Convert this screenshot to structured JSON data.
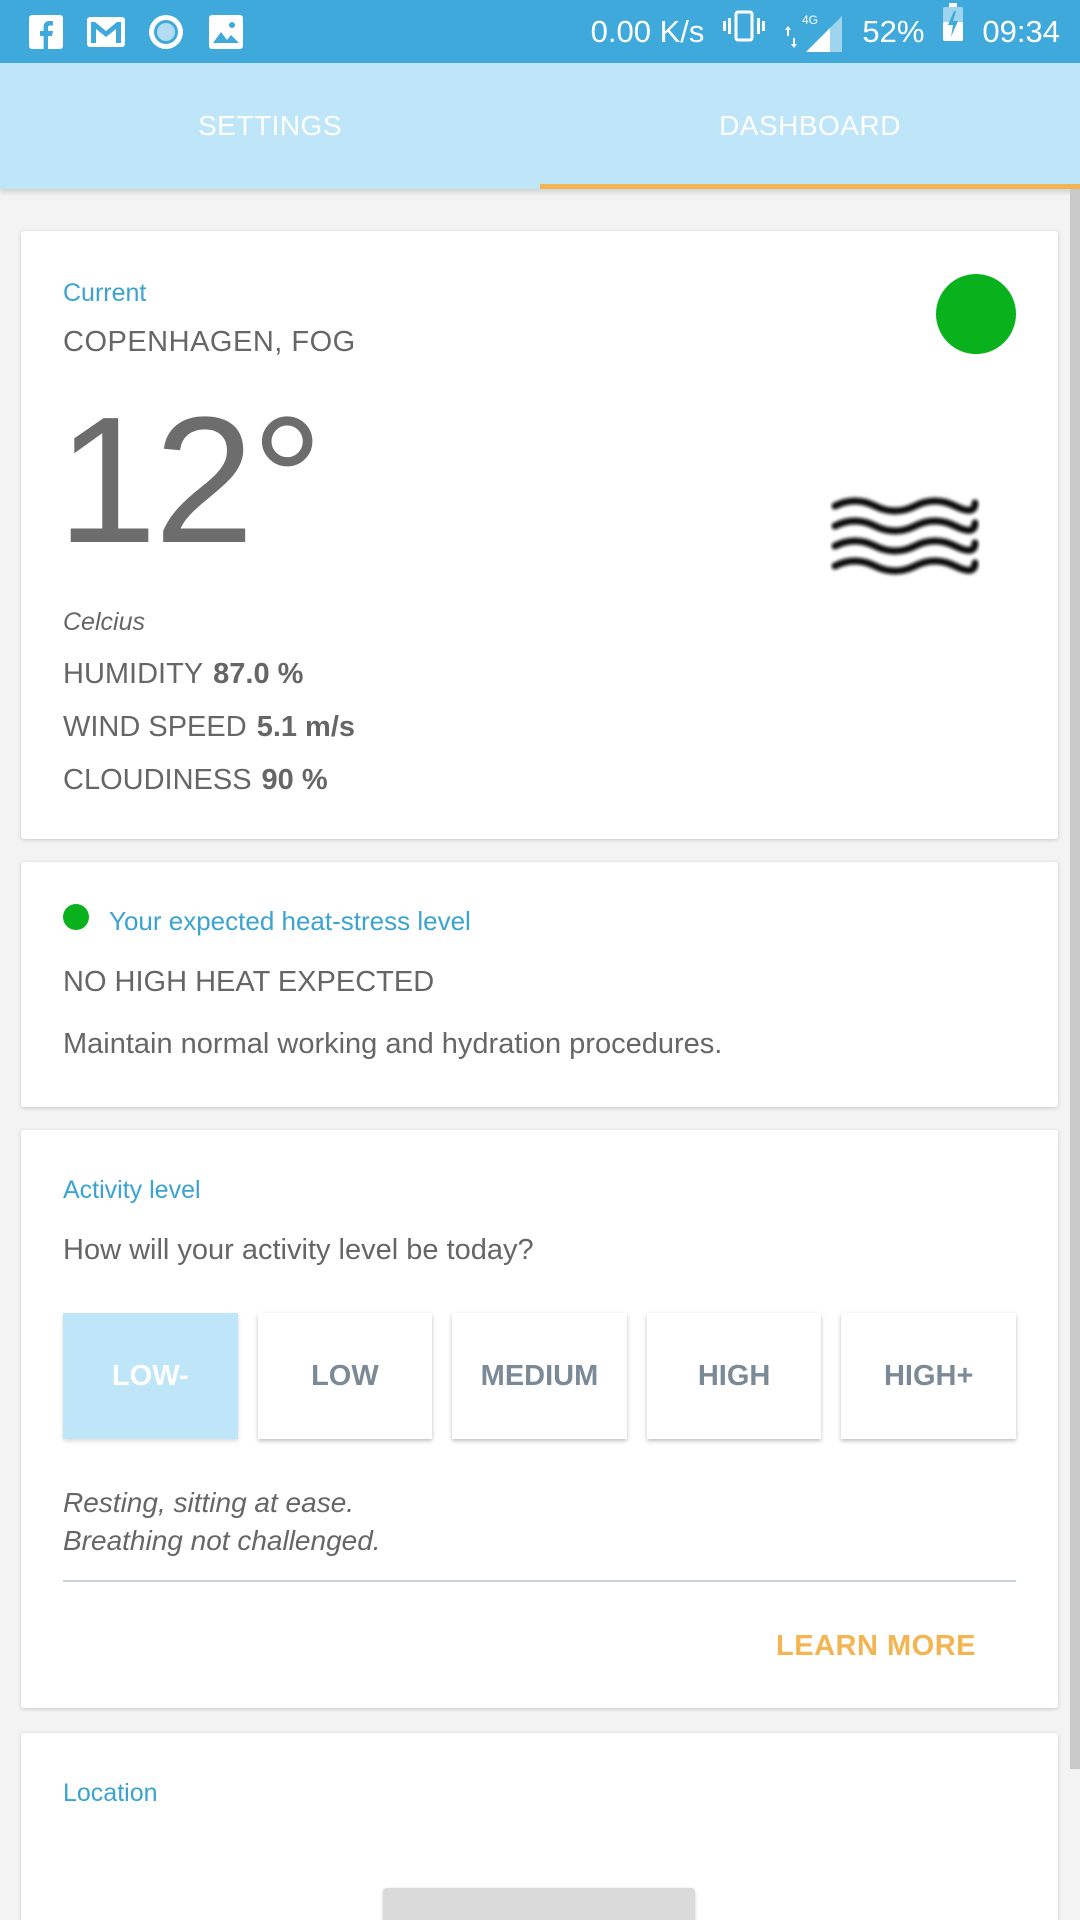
{
  "status_bar": {
    "net_speed": "0.00 K/s",
    "network": "4G",
    "battery": "52%",
    "time": "09:34",
    "left_icons": [
      "facebook-icon",
      "gmail-icon",
      "record-icon",
      "image-icon"
    ]
  },
  "tabs": [
    {
      "label": "SETTINGS",
      "active": false
    },
    {
      "label": "DASHBOARD",
      "active": true
    }
  ],
  "colors": {
    "status_bar": "#3fa9dc",
    "tab_bar": "#bee6f8",
    "indicator": "#f2b552",
    "accent_text": "#3ba3cf",
    "status_green": "#09b11c",
    "learn_more": "#f2b552"
  },
  "current": {
    "title": "Current",
    "location": "COPENHAGEN, FOG",
    "temperature": "12°",
    "unit": "Celcius",
    "weather_icon": "fog-icon",
    "metrics": [
      {
        "label": "HUMIDITY",
        "value": "87.0 %"
      },
      {
        "label": "WIND SPEED",
        "value": "5.1 m/s"
      },
      {
        "label": "CLOUDINESS",
        "value": "90 %"
      }
    ]
  },
  "heat_stress": {
    "title": "Your expected heat-stress level",
    "headline": "NO HIGH HEAT EXPECTED",
    "description": "Maintain normal working and hydration procedures."
  },
  "activity": {
    "title": "Activity level",
    "question": "How will your activity level be today?",
    "levels": [
      "LOW-",
      "LOW",
      "MEDIUM",
      "HIGH",
      "HIGH+"
    ],
    "selected": "LOW-",
    "description_line1": "Resting, sitting at ease.",
    "description_line2": "Breathing not challenged.",
    "learn_more": "LEARN MORE"
  },
  "location": {
    "title": "Location"
  }
}
